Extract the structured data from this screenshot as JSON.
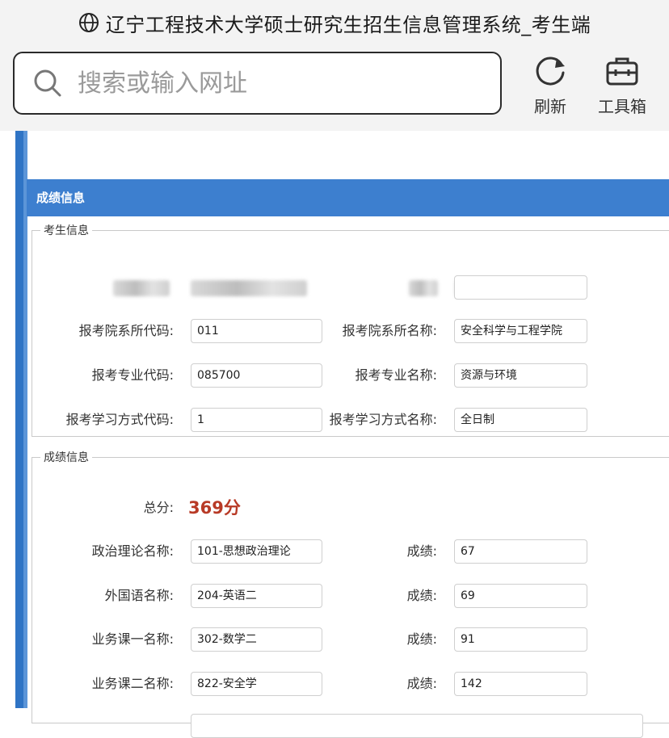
{
  "browser": {
    "title": "辽宁工程技术大学硕士研究生招生信息管理系统_考生端",
    "search": {
      "placeholder": "搜索或输入网址",
      "value": ""
    },
    "refresh_label": "刷新",
    "toolbox_label": "工具箱"
  },
  "panel": {
    "header": "成绩信息"
  },
  "student_info": {
    "legend": "考生信息",
    "college_code_label": "报考院系所代码:",
    "college_code": "011",
    "college_name_label": "报考院系所名称:",
    "college_name": "安全科学与工程学院",
    "major_code_label": "报考专业代码:",
    "major_code": "085700",
    "major_name_label": "报考专业名称:",
    "major_name": "资源与环境",
    "study_mode_code_label": "报考学习方式代码:",
    "study_mode_code": "1",
    "study_mode_name_label": "报考学习方式名称:",
    "study_mode_name": "全日制"
  },
  "score_info": {
    "legend": "成绩信息",
    "total_label": "总分:",
    "total_value": "369分",
    "politics_label": "政治理论名称:",
    "politics_name": "101-思想政治理论",
    "politics_score_label": "成绩:",
    "politics_score": "67",
    "language_label": "外国语名称:",
    "language_name": "204-英语二",
    "language_score_label": "成绩:",
    "language_score": "69",
    "course1_label": "业务课一名称:",
    "course1_name": "302-数学二",
    "course1_score_label": "成绩:",
    "course1_score": "91",
    "course2_label": "业务课二名称:",
    "course2_name": "822-安全学",
    "course2_score_label": "成绩:",
    "course2_score": "142"
  },
  "colors": {
    "header_blue": "#3d7fcf",
    "sidebar_blue": "#2f74c5",
    "total_red": "#b83a26"
  },
  "icons": [
    "globe-icon",
    "search-icon",
    "refresh-icon",
    "toolbox-icon"
  ]
}
